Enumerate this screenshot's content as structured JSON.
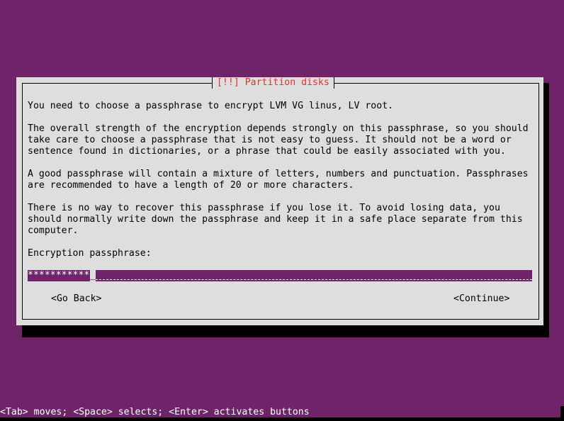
{
  "dialog": {
    "title": "[!!] Partition disks",
    "paragraphs": [
      "You need to choose a passphrase to encrypt LVM VG linus, LV root.",
      "The overall strength of the encryption depends strongly on this passphrase, so you should\ntake care to choose a passphrase that is not easy to guess. It should not be a word or\nsentence found in dictionaries, or a phrase that could be easily associated with you.",
      "A good passphrase will contain a mixture of letters, numbers and punctuation. Passphrases\nare recommended to have a length of 20 or more characters.",
      "There is no way to recover this passphrase if you lose it. To avoid losing data, you\nshould normally write down the passphrase and keep it in a safe place separate from this\ncomputer."
    ],
    "field_label": "Encryption passphrase:",
    "field_value": "************",
    "cursor_char": "_",
    "buttons": {
      "back": "<Go Back>",
      "continue": "<Continue>"
    }
  },
  "help_line": "<Tab> moves; <Space> selects; <Enter> activates buttons",
  "colors": {
    "background": "#6f2469",
    "dialog": "#dedede",
    "title": "#e0302c",
    "shadow": "#000000"
  }
}
